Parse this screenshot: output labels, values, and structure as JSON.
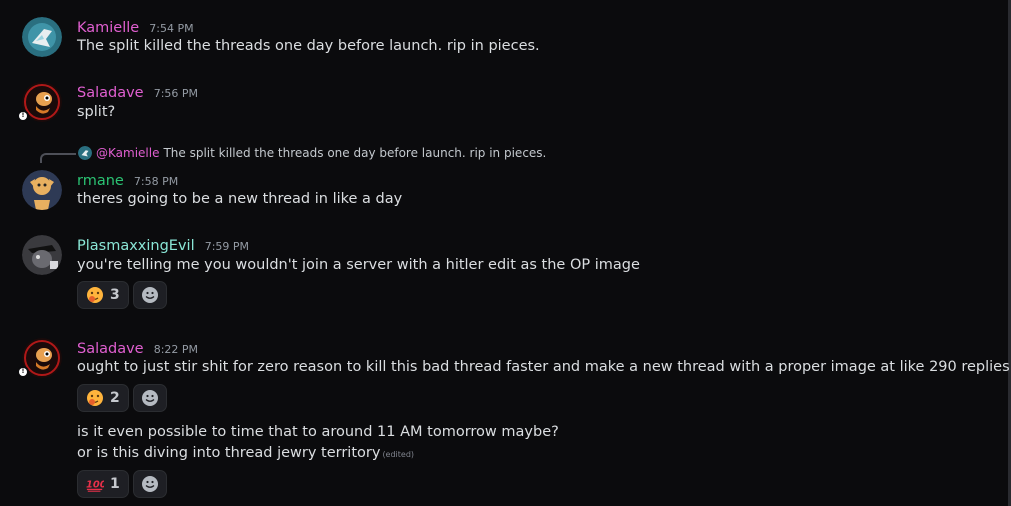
{
  "colors": {
    "background": "#0b0b0d",
    "kamielle": "#e05fd0",
    "saladave": "#e05fd0",
    "rmane": "#2bc373",
    "plasmaxxing": "#8ae6d6",
    "timestamp": "#949ba4",
    "text": "#dbdee1"
  },
  "messages": [
    {
      "username": "Kamielle",
      "time": "7:54 PM",
      "avatar_icon": "avatar-kamielle",
      "lines": [
        "The split killed the threads one day before launch. rip in pieces."
      ]
    },
    {
      "username": "Saladave",
      "time": "7:56 PM",
      "avatar_icon": "avatar-saladave",
      "lines": [
        "split?"
      ]
    },
    {
      "username": "rmane",
      "time": "7:58 PM",
      "avatar_icon": "avatar-rmane",
      "reply": {
        "name": "@Kamielle",
        "text": "The split killed the threads one day before launch. rip in pieces."
      },
      "lines": [
        "theres going to be a new thread in like a day"
      ]
    },
    {
      "username": "PlasmaxxingEvil",
      "time": "7:59 PM",
      "avatar_icon": "avatar-plasmaxxing",
      "lines": [
        "you're telling me you wouldn't join a server with a hitler edit as the OP image"
      ],
      "reactions": [
        {
          "emoji": "thinking-emoji",
          "count": "3"
        }
      ]
    },
    {
      "username": "Saladave",
      "time": "8:22 PM",
      "avatar_icon": "avatar-saladave",
      "lines": [
        "ought to just stir shit for zero reason to kill this bad thread faster and make a new thread with a proper image at like 290 replies"
      ],
      "reactions": [
        {
          "emoji": "thinking-emoji",
          "count": "2"
        }
      ],
      "followup": {
        "lines": [
          "is it even possible to time that to around 11 AM tomorrow maybe?",
          "or is this diving into thread jewry territory"
        ],
        "edited": "(edited)",
        "reactions": [
          {
            "emoji": "hundred-points-emoji",
            "count": "1"
          }
        ]
      }
    }
  ]
}
